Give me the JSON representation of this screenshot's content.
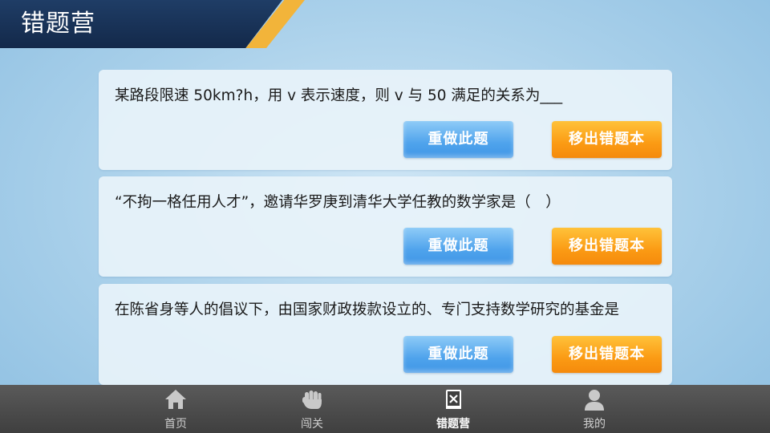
{
  "header": {
    "title": "错题营"
  },
  "questions": [
    {
      "text": "某路段限速 50km?h，用 v 表示速度，则 v 与 50 满足的关系为___",
      "redo_label": "重做此题",
      "remove_label": "移出错题本"
    },
    {
      "text": "“不拘一格任用人才”，邀请华罗庚到清华大学任教的数学家是（　）",
      "redo_label": "重做此题",
      "remove_label": "移出错题本"
    },
    {
      "text": "在陈省身等人的倡议下，由国家财政拨款设立的、专门支持数学研究的基金是",
      "redo_label": "重做此题",
      "remove_label": "移出错题本"
    }
  ],
  "nav": {
    "items": [
      {
        "label": "首页",
        "icon": "home-icon"
      },
      {
        "label": "闯关",
        "icon": "fist-icon"
      },
      {
        "label": "错题营",
        "icon": "notebook-icon",
        "active": true
      },
      {
        "label": "我的",
        "icon": "user-icon"
      }
    ]
  },
  "colors": {
    "header_bg": "#13294a",
    "header_accent": "#f2b43a",
    "redo_button": "#4fa3ec",
    "remove_button": "#fb9b14",
    "nav_bg": "#4a4a4a"
  }
}
